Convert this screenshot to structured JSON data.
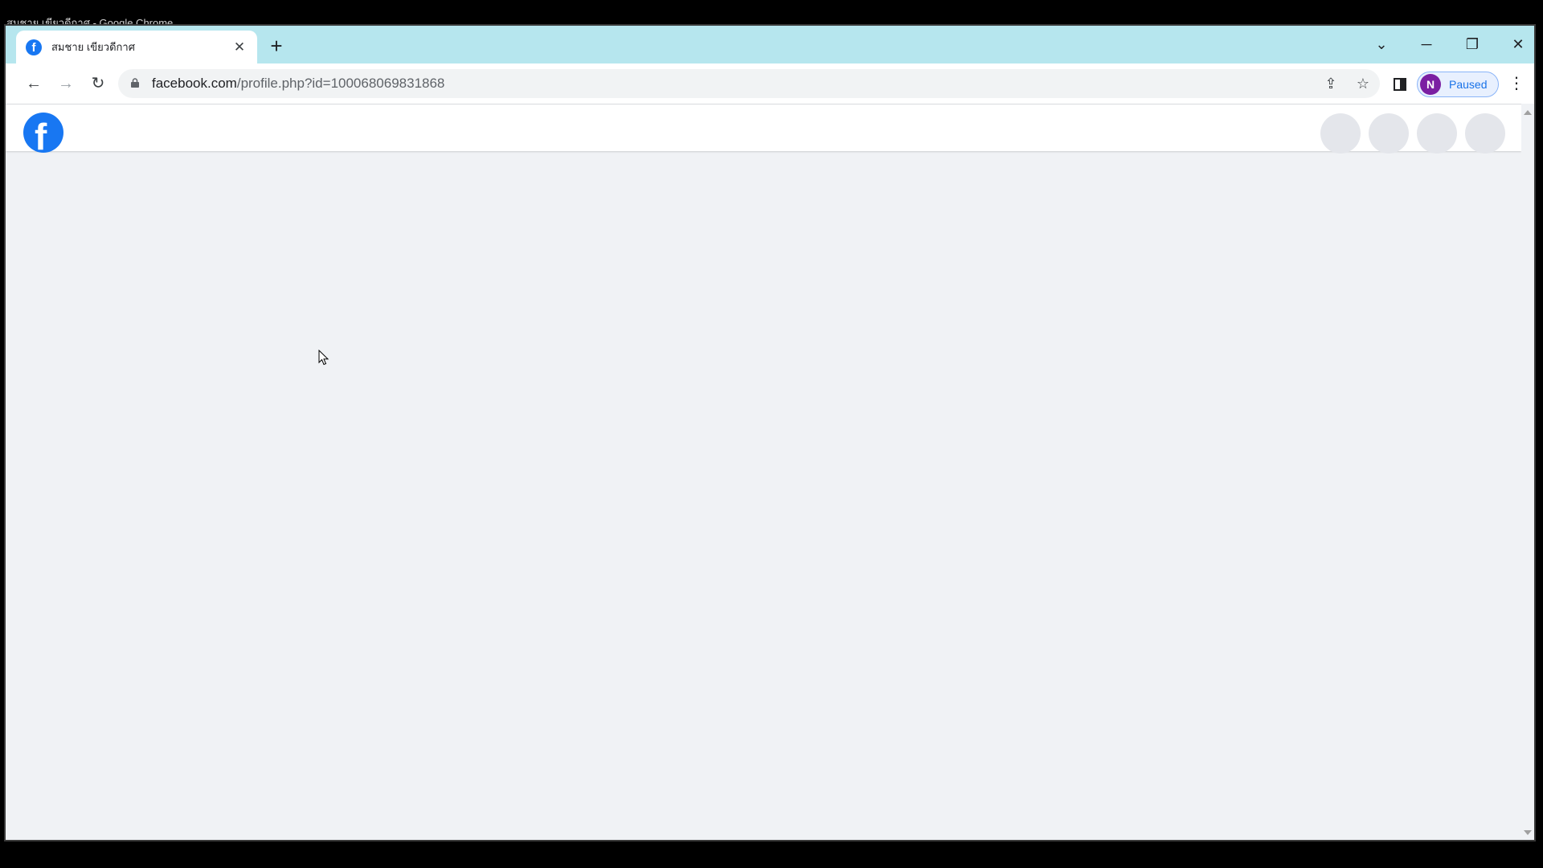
{
  "os": {
    "window_title": "สมชาย เขียวดีกาศ - Google Chrome"
  },
  "browser": {
    "tab": {
      "title": "สมชาย เขียวดีกาศ",
      "favicon": "facebook-icon"
    },
    "new_tab_label": "+",
    "address": {
      "host": "facebook.com",
      "path": "/profile.php?id=100068069831868"
    },
    "profile": {
      "initial": "N",
      "status": "Paused",
      "color": "#7b1fa2"
    }
  },
  "page": {
    "brand_color": "#1877f2",
    "logo_letter": "f",
    "background": "#f0f2f5"
  }
}
